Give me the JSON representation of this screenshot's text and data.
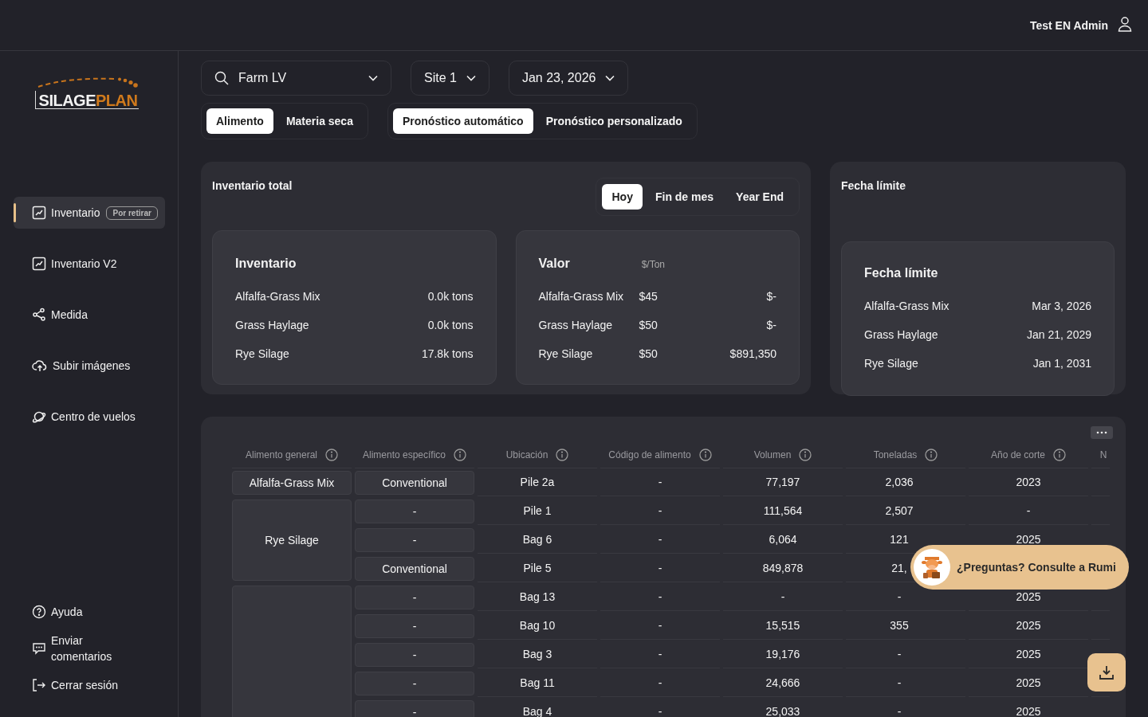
{
  "user": {
    "name": "Test EN Admin"
  },
  "logo": {
    "part_1": "SILAGE",
    "part_2": "PLAN"
  },
  "sidebar": {
    "items": [
      {
        "label": "Inventario",
        "badge": "Por retirar",
        "selected": true,
        "kind": "chart"
      },
      {
        "label": "Inventario V2",
        "selected": false,
        "kind": "chart"
      },
      {
        "label": "Medida",
        "selected": false,
        "kind": "measure"
      },
      {
        "label": "Subir imágenes",
        "selected": false,
        "kind": "upload"
      },
      {
        "label": "Centro de vuelos",
        "selected": false,
        "kind": "planet"
      }
    ],
    "footer": [
      {
        "label": "Ayuda",
        "kind": "help"
      },
      {
        "label": "Enviar comentarios",
        "kind": "chat"
      },
      {
        "label": "Cerrar sesión",
        "kind": "logout"
      }
    ]
  },
  "filters": {
    "farm": {
      "value": "Farm LV"
    },
    "site": {
      "value": "Site 1"
    },
    "date": {
      "value": "Jan 23, 2026"
    }
  },
  "toggles": [
    [
      {
        "label": "Alimento",
        "selected": true
      },
      {
        "label": "Materia seca",
        "selected": false
      }
    ],
    [
      {
        "label": "Pronóstico automático",
        "selected": true
      },
      {
        "label": "Pronóstico personalizado",
        "selected": false
      }
    ]
  ],
  "inventory_total": {
    "title": "Inventario total",
    "periods": [
      {
        "label": "Hoy",
        "selected": true
      },
      {
        "label": "Fin de mes",
        "selected": false
      },
      {
        "label": "Year End",
        "selected": false
      }
    ],
    "inventory": {
      "title": "Inventario",
      "rows": [
        {
          "name": "Alfalfa-Grass Mix",
          "amount": "0.0k tons"
        },
        {
          "name": "Grass Haylage",
          "amount": "0.0k tons"
        },
        {
          "name": "Rye Silage",
          "amount": "17.8k tons"
        }
      ]
    },
    "value": {
      "title": "Valor",
      "unit": "$/Ton",
      "rows": [
        {
          "name": "Alfalfa-Grass Mix",
          "price": "$45",
          "value": "$-"
        },
        {
          "name": "Grass Haylage",
          "price": "$50",
          "value": "$-"
        },
        {
          "name": "Rye Silage",
          "price": "$50",
          "value": "$891,350"
        }
      ]
    }
  },
  "deadline": {
    "title": "Fecha límite",
    "card_title": "Fecha límite",
    "rows": [
      {
        "name": "Alfalfa-Grass Mix",
        "date": "Mar 3, 2026"
      },
      {
        "name": "Grass Haylage",
        "date": "Jan 21, 2029"
      },
      {
        "name": "Rye Silage",
        "date": "Jan 1, 2031"
      }
    ]
  },
  "table": {
    "columns": [
      {
        "label": "Alimento general",
        "info": true
      },
      {
        "label": "Alimento específico",
        "info": true
      },
      {
        "label": "Ubicación",
        "info": true
      },
      {
        "label": "Código de alimento",
        "info": true
      },
      {
        "label": "Volumen",
        "info": true
      },
      {
        "label": "Toneladas",
        "info": true
      },
      {
        "label": "Año de corte",
        "info": true
      },
      {
        "label": "N",
        "info": false
      }
    ],
    "groups": [
      {
        "general": "Alfalfa-Grass Mix",
        "rows": [
          {
            "specific": "Conventional",
            "location": "Pile 2a",
            "code": "-",
            "volume": "77,197",
            "tons": "2,036",
            "year": "2023"
          }
        ]
      },
      {
        "general": "Rye Silage",
        "rows": [
          {
            "specific": "-",
            "location": "Pile 1",
            "code": "-",
            "volume": "111,564",
            "tons": "2,507",
            "year": "-"
          },
          {
            "specific": "-",
            "location": "Bag 6",
            "code": "-",
            "volume": "6,064",
            "tons": "121",
            "year": "2025"
          },
          {
            "specific": "Conventional",
            "location": "Pile 5",
            "code": "-",
            "volume": "849,878",
            "tons": "21,"
          }
        ]
      },
      {
        "rows": [
          {
            "specific": "-",
            "location": "Bag 13",
            "code": "-",
            "volume": "-",
            "tons": "-",
            "year": "2025"
          },
          {
            "specific": "-",
            "location": "Bag 10",
            "code": "-",
            "volume": "15,515",
            "tons": "355",
            "year": "2025"
          },
          {
            "specific": "-",
            "location": "Bag 3",
            "code": "-",
            "volume": "19,176",
            "tons": "-",
            "year": "2025"
          },
          {
            "specific": "-",
            "location": "Bag 11",
            "code": "-",
            "volume": "24,666",
            "tons": "-",
            "year": "2025"
          },
          {
            "specific": "-",
            "location": "Bag 4",
            "code": "-",
            "volume": "25,033",
            "tons": "-",
            "year": "2025"
          }
        ]
      }
    ]
  },
  "help": {
    "text": "¿Preguntas? Consulte a Rumi"
  }
}
